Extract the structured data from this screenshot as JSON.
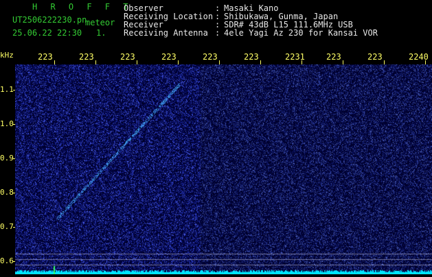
{
  "header": {
    "program_title": "H R O F F T",
    "filename": "UT2506222230.pn",
    "mode": "meteor",
    "datetime": "25.06.22 22:30",
    "count": "1.",
    "fields": [
      {
        "label": "Observer",
        "value": "Masaki Kano"
      },
      {
        "label": "Receiving Location",
        "value": "Shibukawa, Gunma, Japan"
      },
      {
        "label": "Receiver",
        "value": "SDR# 43dB L15 111.6MHz USB"
      },
      {
        "label": "Receiving Antenna",
        "value": "4ele Yagi Az 230 for Kansai VOR"
      }
    ]
  },
  "time_axis": {
    "labels": [
      "223",
      "223",
      "223",
      "223",
      "223",
      "223",
      "2231",
      "223",
      "223",
      "2240"
    ]
  },
  "freq_axis": {
    "unit": "kHz",
    "labels": [
      "1.1",
      "1.0",
      "0.9",
      "0.8",
      "0.7",
      "0.6"
    ]
  },
  "colors": {
    "background": "#000000",
    "header_text": "#e8e8e8",
    "title_text": "#33cc33",
    "axis_text": "#ffff66",
    "noise_dark": "#00006e",
    "noise_bright": "#2a4cff",
    "carrier": "#00e5ff"
  }
}
